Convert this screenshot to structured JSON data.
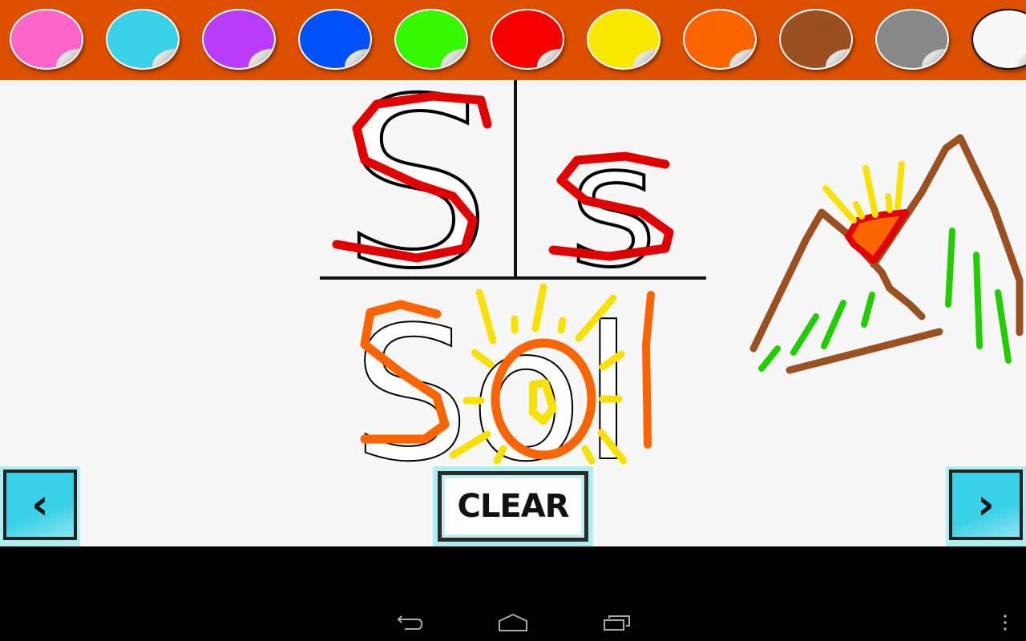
{
  "palette": {
    "colors": [
      {
        "name": "pink",
        "hex": "#fc66c8"
      },
      {
        "name": "cyan",
        "hex": "#3bd1e8"
      },
      {
        "name": "purple",
        "hex": "#b83cf8"
      },
      {
        "name": "blue",
        "hex": "#0050f8"
      },
      {
        "name": "green",
        "hex": "#33f800"
      },
      {
        "name": "red",
        "hex": "#f80000"
      },
      {
        "name": "yellow",
        "hex": "#f8e800"
      },
      {
        "name": "orange",
        "hex": "#fc6400"
      },
      {
        "name": "brown",
        "hex": "#9a5020"
      },
      {
        "name": "gray",
        "hex": "#888888"
      },
      {
        "name": "white",
        "hex": "#f8f8f8"
      }
    ],
    "background": "#dc5000"
  },
  "canvas": {
    "upper_letter": "S",
    "lower_letter": "s",
    "word": "Sol"
  },
  "buttons": {
    "prev_icon": "chevron-left-icon",
    "prev_glyph": "‹",
    "clear_label": "CLEAR",
    "next_icon": "chevron-right-icon",
    "next_glyph": "›"
  },
  "system_nav": {
    "back": "back-icon",
    "home": "home-icon",
    "recents": "recents-icon",
    "menu": "overflow-menu-icon"
  }
}
